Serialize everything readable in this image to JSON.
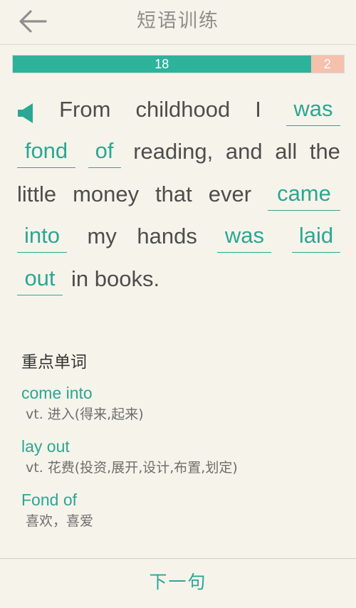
{
  "header": {
    "title": "短语训练",
    "back_icon": "arrow-left-icon"
  },
  "progress": {
    "done_count": "18",
    "remaining_count": "2",
    "done_color": "#2db39b",
    "remaining_color": "#f5c1ad"
  },
  "sentence": {
    "speaker_icon": "speaker-icon",
    "segments": {
      "t1": "From",
      "t2": "childhood",
      "t3": "I",
      "b1": "was",
      "b2": "fond",
      "b3": "of",
      "t4": "reading,",
      "t5": "and",
      "t6": "all",
      "t7": "the",
      "t8": "little",
      "t9": "money",
      "t10": "that",
      "t11": "ever",
      "b4": "came",
      "b5": "into",
      "t12": "my",
      "t13": "hands",
      "b6": "was",
      "b7": "laid",
      "b8": "out",
      "t14": "in books."
    }
  },
  "vocab": {
    "heading": "重点单词",
    "items": [
      {
        "word": "come into",
        "definition": "vt. 进入(得来,起来)"
      },
      {
        "word": "lay out",
        "definition": "vt. 花费(投资,展开,设计,布置,划定)"
      },
      {
        "word": "Fond of",
        "definition": "喜欢，喜爱"
      }
    ]
  },
  "footer": {
    "next_label": "下一句"
  },
  "colors": {
    "accent": "#2aa795",
    "background": "#f6f4ea"
  }
}
